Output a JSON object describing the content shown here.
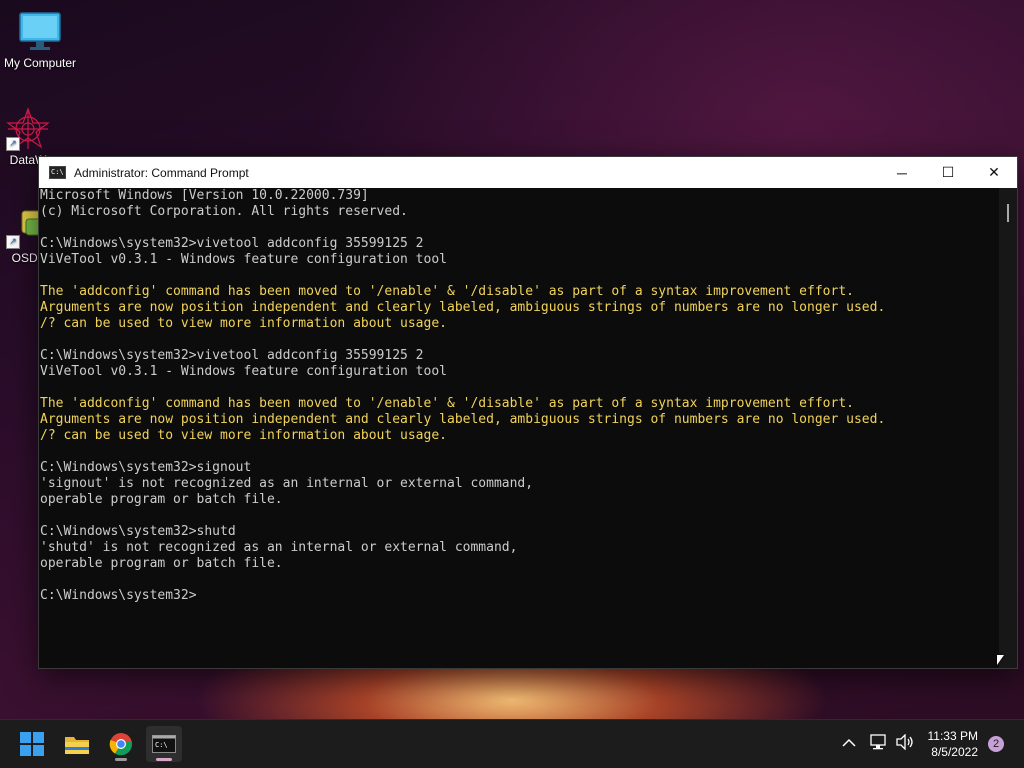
{
  "desktop": {
    "icons": [
      {
        "label": "My Computer",
        "icon": "monitor-icon"
      },
      {
        "label": "DataW",
        "icon": "datawrapper-icon"
      },
      {
        "label": "OSDo",
        "icon": "osd-icon"
      }
    ]
  },
  "window": {
    "title": "Administrator: Command Prompt",
    "controls": {
      "minimize": "─",
      "maximize": "☐",
      "close": "✕"
    },
    "lines": [
      {
        "text": "Microsoft Windows [Version 10.0.22000.739]",
        "color": "normal"
      },
      {
        "text": "(c) Microsoft Corporation. All rights reserved.",
        "color": "normal"
      },
      {
        "text": "",
        "color": "normal"
      },
      {
        "text": "C:\\Windows\\system32>vivetool addconfig 35599125 2",
        "color": "normal"
      },
      {
        "text": "ViVeTool v0.3.1 - Windows feature configuration tool",
        "color": "normal"
      },
      {
        "text": "",
        "color": "normal"
      },
      {
        "text": "The 'addconfig' command has been moved to '/enable' & '/disable' as part of a syntax improvement effort.",
        "color": "yellow"
      },
      {
        "text": "Arguments are now position independent and clearly labeled, ambiguous strings of numbers are no longer used.",
        "color": "yellow"
      },
      {
        "text": "/? can be used to view more information about usage.",
        "color": "yellow"
      },
      {
        "text": "",
        "color": "normal"
      },
      {
        "text": "C:\\Windows\\system32>vivetool addconfig 35599125 2",
        "color": "normal"
      },
      {
        "text": "ViVeTool v0.3.1 - Windows feature configuration tool",
        "color": "normal"
      },
      {
        "text": "",
        "color": "normal"
      },
      {
        "text": "The 'addconfig' command has been moved to '/enable' & '/disable' as part of a syntax improvement effort.",
        "color": "yellow"
      },
      {
        "text": "Arguments are now position independent and clearly labeled, ambiguous strings of numbers are no longer used.",
        "color": "yellow"
      },
      {
        "text": "/? can be used to view more information about usage.",
        "color": "yellow"
      },
      {
        "text": "",
        "color": "normal"
      },
      {
        "text": "C:\\Windows\\system32>signout",
        "color": "normal"
      },
      {
        "text": "'signout' is not recognized as an internal or external command,",
        "color": "normal"
      },
      {
        "text": "operable program or batch file.",
        "color": "normal"
      },
      {
        "text": "",
        "color": "normal"
      },
      {
        "text": "C:\\Windows\\system32>shutd",
        "color": "normal"
      },
      {
        "text": "'shutd' is not recognized as an internal or external command,",
        "color": "normal"
      },
      {
        "text": "operable program or batch file.",
        "color": "normal"
      },
      {
        "text": "",
        "color": "normal"
      },
      {
        "text": "C:\\Windows\\system32>",
        "color": "normal"
      }
    ]
  },
  "taskbar": {
    "apps": [
      {
        "name": "start-button",
        "icon": "windows-logo-icon"
      },
      {
        "name": "file-explorer-button",
        "icon": "folder-icon"
      },
      {
        "name": "chrome-button",
        "icon": "chrome-icon"
      },
      {
        "name": "command-prompt-button",
        "icon": "terminal-icon",
        "active": true
      }
    ],
    "tray": {
      "chevron": "^",
      "time": "11:33 PM",
      "date": "8/5/2022",
      "notifications": "2"
    }
  },
  "colors": {
    "console_text": "#cccccc",
    "console_warning": "#f0d35a",
    "console_bg": "#0c0c0c",
    "taskbar_bg": "#1c1c1c"
  }
}
